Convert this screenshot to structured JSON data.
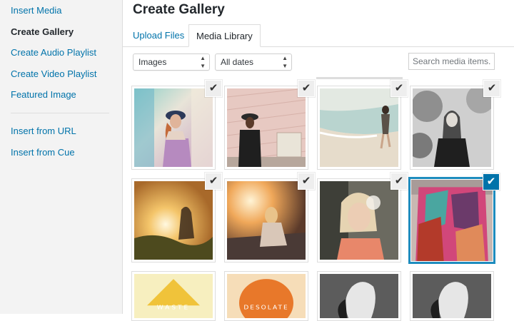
{
  "sidebar": {
    "items": [
      {
        "label": "Insert Media",
        "active": false
      },
      {
        "label": "Create Gallery",
        "active": true
      },
      {
        "label": "Create Audio Playlist",
        "active": false
      },
      {
        "label": "Create Video Playlist",
        "active": false
      },
      {
        "label": "Featured Image",
        "active": false
      },
      {
        "label": "Insert from URL",
        "active": false
      },
      {
        "label": "Insert from Cue",
        "active": false
      }
    ]
  },
  "header": {
    "title": "Create Gallery"
  },
  "tabs": [
    {
      "label": "Upload Files",
      "active": false
    },
    {
      "label": "Media Library",
      "active": true
    }
  ],
  "filters": {
    "type_select": "Images",
    "date_select": "All dates",
    "search_placeholder": "Search media items."
  },
  "media": [
    {
      "name": "girl-graffiti-photo",
      "checked": true,
      "selected": false
    },
    {
      "name": "girl-brick-wall-photo",
      "checked": true,
      "selected": false
    },
    {
      "name": "beach-walk-photo",
      "checked": true,
      "selected": false
    },
    {
      "name": "girl-black-white-photo",
      "checked": true,
      "selected": false
    },
    {
      "name": "sunset-field-photo",
      "checked": true,
      "selected": false
    },
    {
      "name": "girl-sitting-sunset-photo",
      "checked": true,
      "selected": false
    },
    {
      "name": "girl-dandelion-photo",
      "checked": true,
      "selected": false
    },
    {
      "name": "colorful-scarf-photo",
      "checked": true,
      "selected": true
    },
    {
      "name": "waste-album-art",
      "text": "WASTE",
      "checked": false,
      "selected": false
    },
    {
      "name": "desolate-album-art",
      "text": "DESOLATE",
      "checked": false,
      "selected": false
    },
    {
      "name": "profile-bw-photo-1",
      "checked": false,
      "selected": false
    },
    {
      "name": "profile-bw-photo-2",
      "checked": false,
      "selected": false
    }
  ],
  "colors": {
    "link": "#0073aa",
    "selected_border": "#1e8cbe",
    "check_active": "#0073aa"
  },
  "icons": {
    "check": "✔",
    "select_chevron": "up-down-chevron-icon"
  }
}
